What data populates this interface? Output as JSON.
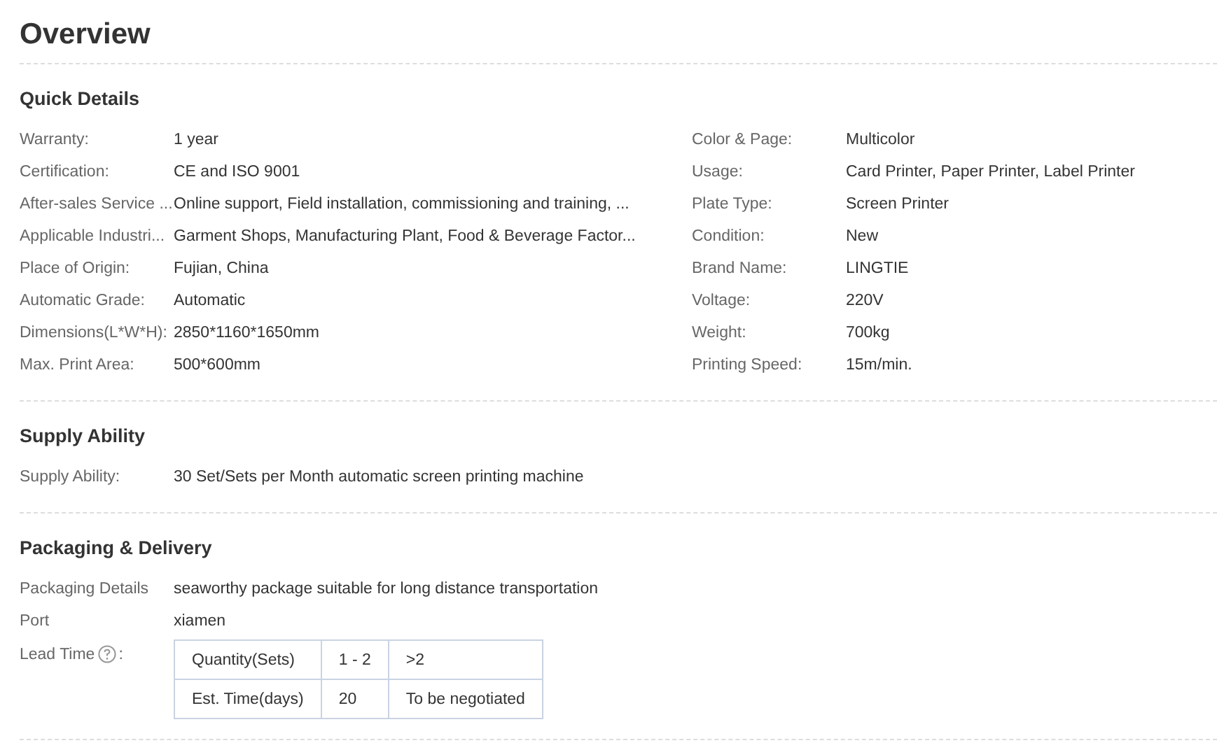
{
  "title": "Overview",
  "sections": [
    {
      "kind": "details",
      "heading": "Quick Details",
      "columns": [
        [
          {
            "label": "Warranty:",
            "value": "1 year"
          },
          {
            "label": "Certification:",
            "value": "CE and ISO 9001"
          },
          {
            "label": "After-sales Service ...",
            "value": "Online support, Field installation, commissioning and training, ..."
          },
          {
            "label": "Applicable Industri...",
            "value": "Garment Shops, Manufacturing Plant, Food & Beverage Factor..."
          },
          {
            "label": "Place of Origin:",
            "value": "Fujian, China"
          },
          {
            "label": "Automatic Grade:",
            "value": "Automatic"
          },
          {
            "label": "Dimensions(L*W*H):",
            "value": "2850*1160*1650mm"
          },
          {
            "label": "Max. Print Area:",
            "value": "500*600mm"
          }
        ],
        [
          {
            "label": "Color & Page:",
            "value": "Multicolor"
          },
          {
            "label": "Usage:",
            "value": "Card Printer, Paper Printer, Label Printer"
          },
          {
            "label": "Plate Type:",
            "value": "Screen Printer"
          },
          {
            "label": "Condition:",
            "value": "New"
          },
          {
            "label": "Brand Name:",
            "value": "LINGTIE"
          },
          {
            "label": "Voltage:",
            "value": "220V"
          },
          {
            "label": "Weight:",
            "value": "700kg"
          },
          {
            "label": "Printing Speed:",
            "value": "15m/min."
          }
        ]
      ]
    },
    {
      "kind": "details",
      "heading": "Supply Ability",
      "columns": [
        [
          {
            "label": "Supply Ability:",
            "value": "30 Set/Sets per Month automatic screen printing machine"
          }
        ]
      ]
    },
    {
      "kind": "delivery",
      "heading": "Packaging & Delivery",
      "rows": [
        {
          "label": "Packaging Details",
          "value": "seaworthy package suitable for long distance transportation"
        },
        {
          "label": "Port",
          "value": "xiamen"
        }
      ],
      "lead_time": {
        "label": "Lead Time",
        "colon": ":",
        "table": [
          [
            "Quantity(Sets)",
            "1 - 2",
            ">2"
          ],
          [
            "Est. Time(days)",
            "20",
            "To be negotiated"
          ]
        ]
      }
    }
  ]
}
